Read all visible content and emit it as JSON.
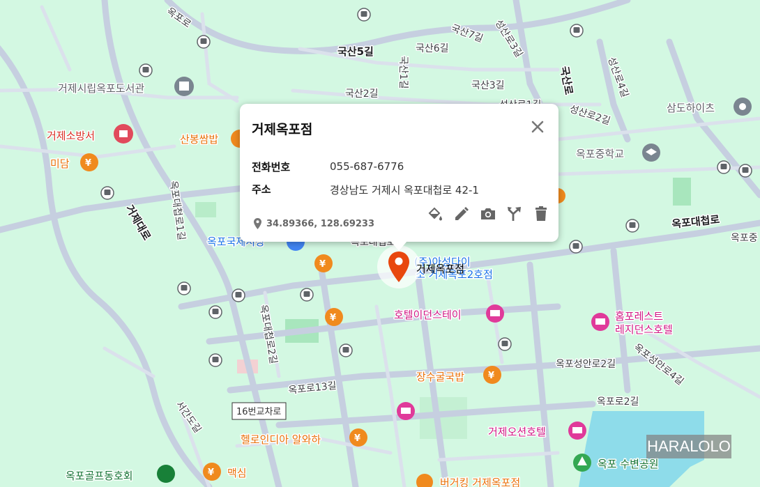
{
  "popup": {
    "title": "거제옥포점",
    "phone_label": "전화번호",
    "phone_value": "055-687-6776",
    "address_label": "주소",
    "address_value": "경상남도 거제시 옥포대첩로 42-1",
    "coordinates": "34.89366, 128.69233",
    "tools": [
      "paint-bucket-icon",
      "pencil-icon",
      "camera-icon",
      "directions-fork-icon",
      "trash-icon"
    ]
  },
  "marker": {
    "label": "거제옥포점",
    "color": "#e8470e"
  },
  "watermark": "HARALOLO",
  "map": {
    "roads": [
      "옥포로",
      "국산5길",
      "국산6길",
      "국산7길",
      "성산로3길",
      "국산1길",
      "국산2길",
      "국산3길",
      "성산로1길",
      "성산로2길",
      "성산로4길",
      "국산로",
      "옥포대첩로",
      "옥포대첩로",
      "옥포대첩로1길",
      "거제대로",
      "옥포대첩로2길",
      "옥포로13길",
      "옥포성안로2길",
      "옥포성안로4길",
      "옥포로2길",
      "서간도길",
      "16번교차로",
      "옥포중"
    ],
    "pois": [
      "거제시립옥포도서관",
      "거제소방서",
      "미담",
      "산봉쌈밥",
      "옥포국제시장",
      "(주)아성다이",
      "소 거제옥포2호점",
      "호텔이던스테이",
      "홈포레스트",
      "레지던스호텔",
      "장수굴국밥",
      "헬로인디아 알와하",
      "거제오션호텔",
      "옥포 수변공원",
      "옥포골프동호회",
      "맥심",
      "버거킹 거제옥포점",
      "삼도하이츠",
      "옥포중학교"
    ]
  }
}
